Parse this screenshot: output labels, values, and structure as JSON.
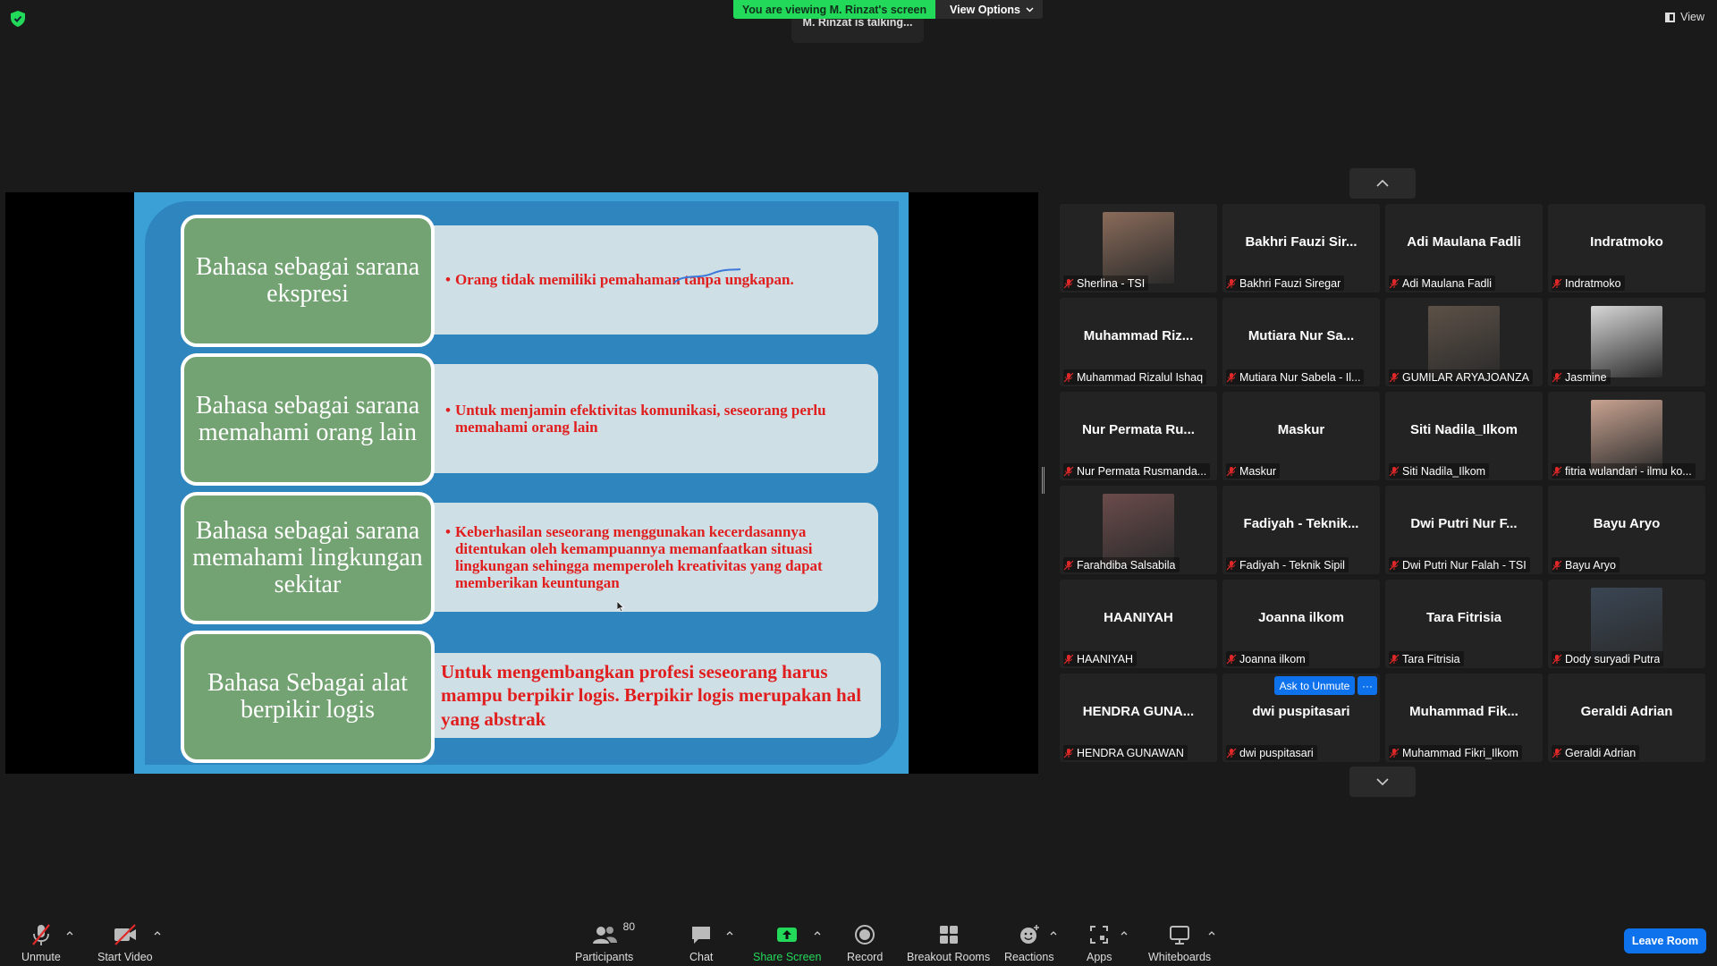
{
  "banner": {
    "viewing": "You are viewing M. Rinzat's screen",
    "view_options": "View Options",
    "talking": "M. Rinzat is talking...",
    "view": "View"
  },
  "slide": {
    "rows": [
      {
        "label": "Bahasa sebagai sarana ekspresi",
        "text": "Orang tidak memiliki pemahaman tanpa ungkapan."
      },
      {
        "label": "Bahasa sebagai sarana memahami orang lain",
        "text": "Untuk menjamin efektivitas komunikasi, seseorang perlu memahami orang lain"
      },
      {
        "label": "Bahasa sebagai sarana memahami lingkungan sekitar",
        "text": "Keberhasilan seseorang menggunakan kecerdasannya ditentukan oleh kemampuannya memanfaatkan situasi lingkungan sehingga memperoleh kreativitas yang dapat memberikan keuntungan"
      },
      {
        "label": "Bahasa Sebagai alat berpikir logis",
        "text": "Untuk mengembangkan profesi seseorang harus mampu berpikir logis. Berpikir logis merupakan hal yang abstrak"
      }
    ],
    "bullet": "•"
  },
  "gallery": {
    "tiles": [
      {
        "big": "",
        "small": "Sherlina - TSI",
        "photo": true
      },
      {
        "big": "Bakhri Fauzi Sir...",
        "small": "Bakhri Fauzi Siregar"
      },
      {
        "big": "Adi Maulana Fadli",
        "small": "Adi Maulana Fadli"
      },
      {
        "big": "Indratmoko",
        "small": "Indratmoko"
      },
      {
        "big": "Muhammad Riz...",
        "small": "Muhammad Rizalul Ishaq"
      },
      {
        "big": "Mutiara Nur Sa...",
        "small": "Mutiara Nur Sabela - Il..."
      },
      {
        "big": "",
        "small": "GUMILAR ARYAJOANZA",
        "photo": true
      },
      {
        "big": "",
        "small": "Jasmine",
        "photo": true
      },
      {
        "big": "Nur Permata Ru...",
        "small": "Nur Permata Rusmanda..."
      },
      {
        "big": "Maskur",
        "small": "Maskur"
      },
      {
        "big": "Siti Nadila_Ilkom",
        "small": "Siti Nadila_Ilkom"
      },
      {
        "big": "",
        "small": "fitria wulandari - ilmu ko...",
        "photo": true
      },
      {
        "big": "",
        "small": "Farahdiba Salsabila",
        "photo": true
      },
      {
        "big": "Fadiyah - Teknik...",
        "small": "Fadiyah - Teknik Sipil"
      },
      {
        "big": "Dwi Putri Nur F...",
        "small": "Dwi Putri Nur Falah - TSI"
      },
      {
        "big": "Bayu Aryo",
        "small": "Bayu Aryo"
      },
      {
        "big": "HAANIYAH",
        "small": "HAANIYAH"
      },
      {
        "big": "Joanna ilkom",
        "small": "Joanna ilkom"
      },
      {
        "big": "Tara Fitrisia",
        "small": "Tara Fitrisia"
      },
      {
        "big": "",
        "small": "Dody suryadi Putra",
        "photo": true
      },
      {
        "big": "HENDRA GUNA...",
        "small": "HENDRA GUNAWAN"
      },
      {
        "big": "dwi puspitasari",
        "small": "dwi puspitasari"
      },
      {
        "big": "Muhammad Fik...",
        "small": "Muhammad Fikri_Ilkom"
      },
      {
        "big": "Geraldi Adrian",
        "small": "Geraldi Adrian"
      }
    ],
    "ask_to_unmute": "Ask to Unmute",
    "more": "···"
  },
  "toolbar": {
    "unmute": "Unmute",
    "start_video": "Start Video",
    "participants": "Participants",
    "participants_count": "80",
    "chat": "Chat",
    "share_screen": "Share Screen",
    "record": "Record",
    "breakout_rooms": "Breakout Rooms",
    "reactions": "Reactions",
    "apps": "Apps",
    "whiteboards": "Whiteboards",
    "leave_room": "Leave Room"
  },
  "colors": {
    "accent_green": "#23d959",
    "accent_blue": "#0e72ed",
    "slide_text_red": "#e01e1e",
    "slide_label_green": "#74a373"
  }
}
